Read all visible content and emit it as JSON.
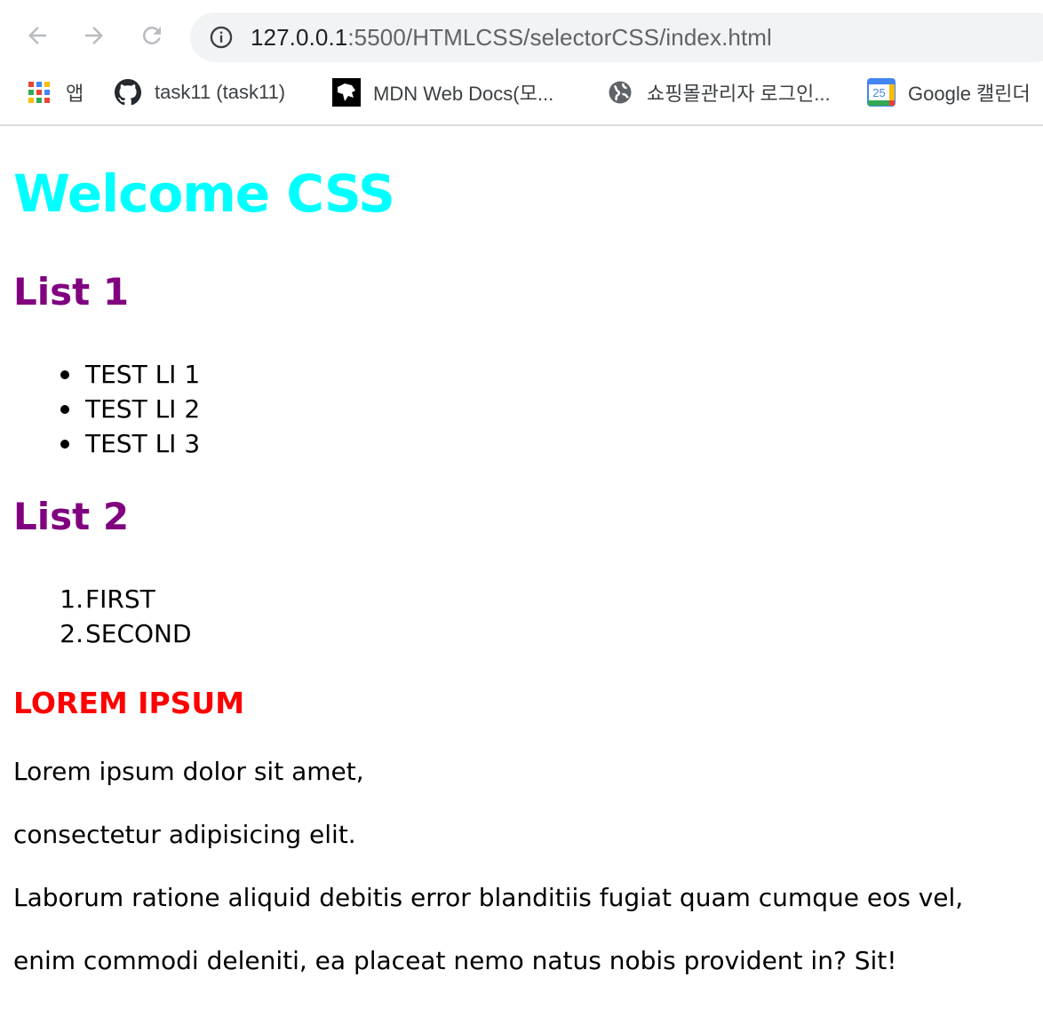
{
  "browser": {
    "url_host": "127.0.0.1",
    "url_rest": ":5500/HTMLCSS/selectorCSS/index.html",
    "bookmarks": [
      {
        "label": "앱",
        "icon": "apps-grid-icon"
      },
      {
        "label": "task11 (task11)",
        "icon": "github-icon"
      },
      {
        "label": "MDN Web Docs(모...",
        "icon": "mdn-icon"
      },
      {
        "label": "쇼핑몰관리자 로그인...",
        "icon": "globe-icon"
      },
      {
        "label": "Google 캘린더",
        "icon": "google-calendar-icon"
      }
    ],
    "calendar_day": "25"
  },
  "page": {
    "title": "Welcome CSS",
    "list1": {
      "heading": "List 1",
      "items": [
        "TEST LI 1",
        "TEST LI 2",
        "TEST LI 3"
      ]
    },
    "list2": {
      "heading": "List 2",
      "items": [
        "FIRST",
        "SECOND"
      ],
      "numbers": [
        "1.",
        "2."
      ]
    },
    "lorem_heading": "LOREM IPSUM",
    "paragraphs": [
      "Lorem ipsum dolor sit amet,",
      "consectetur adipisicing elit.",
      "Laborum ratione aliquid debitis error blanditiis fugiat quam cumque eos vel,",
      "enim commodi deleniti, ea placeat nemo natus nobis provident in? Sit!"
    ]
  },
  "colors": {
    "title": "#00ffff",
    "list_heading": "#800080",
    "lorem_heading": "#ff0000"
  }
}
